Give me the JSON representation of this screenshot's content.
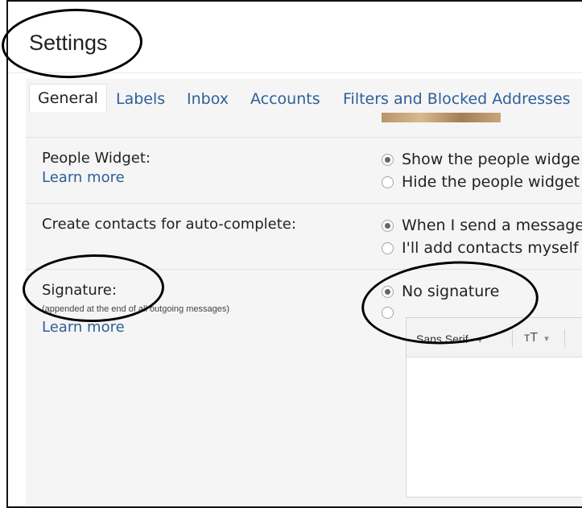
{
  "header": {
    "title": "Settings"
  },
  "tabs": [
    "General",
    "Labels",
    "Inbox",
    "Accounts",
    "Filters and Blocked Addresses"
  ],
  "people_widget": {
    "label": "People Widget:",
    "learn_more": "Learn more",
    "options": [
      "Show the people widge",
      "Hide the people widget"
    ]
  },
  "contacts": {
    "label": "Create contacts for auto-complete:",
    "options": [
      "When I send a message",
      "I'll add contacts myself"
    ]
  },
  "signature": {
    "label": "Signature:",
    "note": "(appended at the end of all outgoing messages)",
    "learn_more": "Learn more",
    "options": [
      "No signature",
      ""
    ],
    "editor": {
      "font": "Sans Serif",
      "size_icon": "тT",
      "chevron": "▾"
    }
  },
  "colors": {
    "link": "#2d5f9a",
    "panel": "#f5f5f5",
    "annotation": "#000000"
  },
  "icons": [
    "radio-button",
    "text-size-icon",
    "chevron-down-icon"
  ]
}
